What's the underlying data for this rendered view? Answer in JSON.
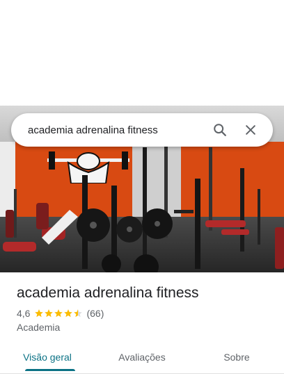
{
  "search": {
    "query": "academia adrenalina fitness",
    "search_icon": "search-icon",
    "clear_icon": "close-icon"
  },
  "place": {
    "name": "academia adrenalina fitness",
    "rating": "4,6",
    "stars_filled": 4.5,
    "review_count": "(66)",
    "category": "Academia",
    "star_color": "#fbbc04"
  },
  "tabs": [
    {
      "label": "Visão geral",
      "active": true
    },
    {
      "label": "Avaliações",
      "active": false
    },
    {
      "label": "Sobre",
      "active": false
    }
  ],
  "colors": {
    "accent": "#0b7285"
  }
}
